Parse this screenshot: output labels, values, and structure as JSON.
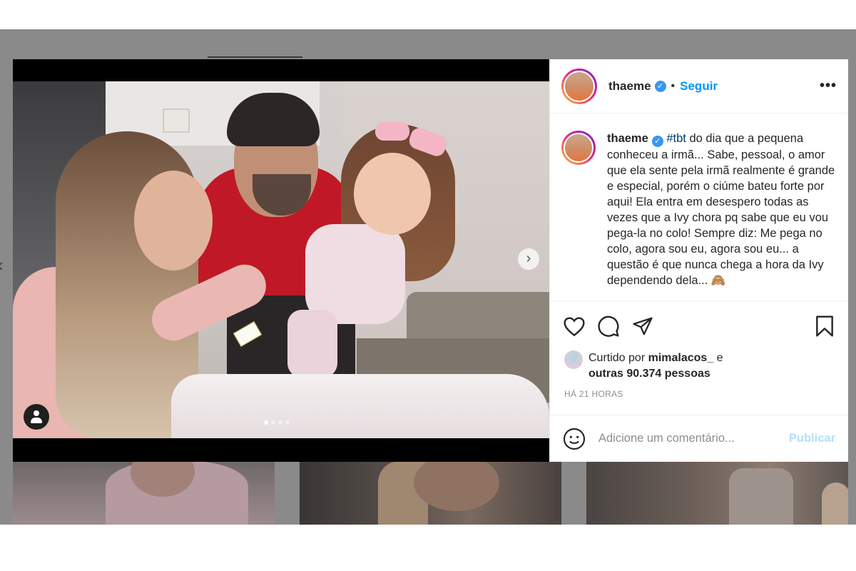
{
  "post": {
    "username": "thaeme",
    "verified_icon": "verified-badge-icon",
    "separator": "•",
    "follow_label": "Seguir",
    "more_icon": "more-options-icon",
    "more_glyph": "•••",
    "caption": {
      "username": "thaeme",
      "hashtag": "#tbt",
      "text": " do dia que a pequena conheceu a irmã... Sabe, pessoal, o amor que ela sente pela irmã realmente é grande e especial, porém o ciúme bateu forte por aqui! Ela entra em desespero todas as vezes que a Ivy chora pq sabe que eu vou pega-la no colo! Sempre diz: Me pega no colo, agora sou eu, agora sou eu... a questão é que nunca chega a hora da Ivy dependendo dela... 🙈"
    },
    "likes": {
      "prefix": "Curtido por ",
      "user": "mimalacos_",
      "connector": " e",
      "others": "outras 90.374 pessoas"
    },
    "timestamp": "HÁ 21 HORAS",
    "comment_placeholder": "Adicione um comentário...",
    "publish_label": "Publicar"
  },
  "carousel": {
    "slide_count": 4,
    "active_slide": 1,
    "next_glyph": "›"
  },
  "background": {
    "left_arrow_glyph": "‹"
  },
  "colors": {
    "link_blue": "#0095f6",
    "publish_disabled": "#b2dffc",
    "text": "#262626",
    "muted": "#8e8e8e"
  }
}
